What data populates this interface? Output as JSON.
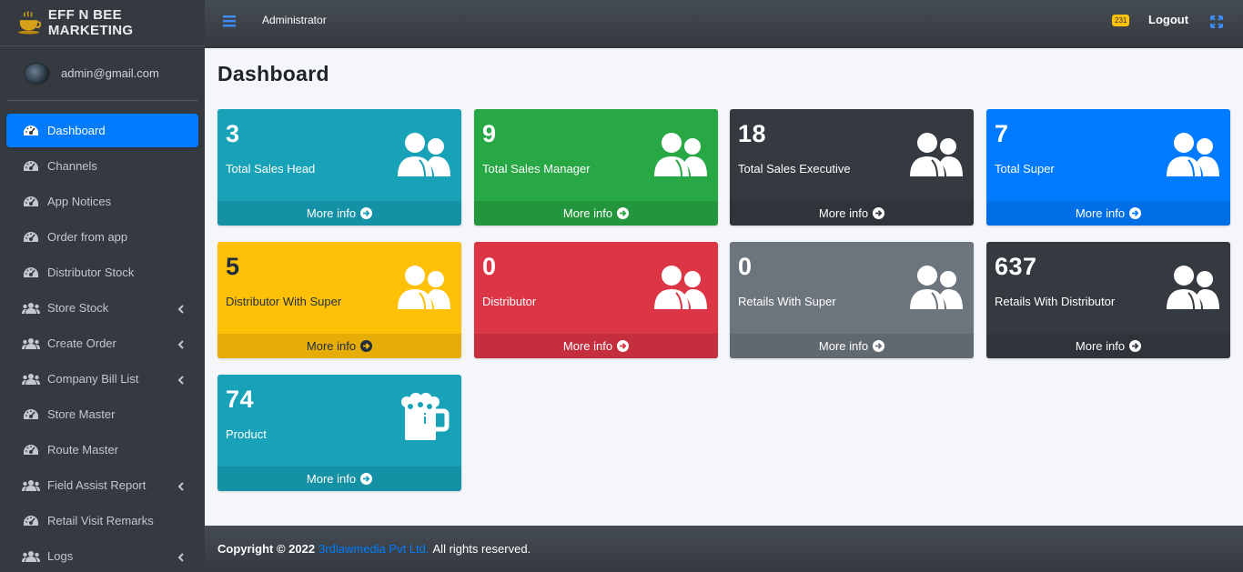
{
  "brand": {
    "name": "EFF N BEE MARKETING"
  },
  "user": {
    "email": "admin@gmail.com"
  },
  "sidebar": {
    "items": [
      {
        "label": "Dashboard",
        "icon": "tachometer-icon",
        "active": true,
        "arrow": false
      },
      {
        "label": "Channels",
        "icon": "tachometer-icon",
        "active": false,
        "arrow": false
      },
      {
        "label": "App Notices",
        "icon": "tachometer-icon",
        "active": false,
        "arrow": false
      },
      {
        "label": "Order from app",
        "icon": "tachometer-icon",
        "active": false,
        "arrow": false
      },
      {
        "label": "Distributor Stock",
        "icon": "tachometer-icon",
        "active": false,
        "arrow": false
      },
      {
        "label": "Store Stock",
        "icon": "users-icon",
        "active": false,
        "arrow": true
      },
      {
        "label": "Create Order",
        "icon": "users-icon",
        "active": false,
        "arrow": true
      },
      {
        "label": "Company Bill List",
        "icon": "users-icon",
        "active": false,
        "arrow": true
      },
      {
        "label": "Store Master",
        "icon": "tachometer-icon",
        "active": false,
        "arrow": false
      },
      {
        "label": "Route Master",
        "icon": "tachometer-icon",
        "active": false,
        "arrow": false
      },
      {
        "label": "Field Assist Report",
        "icon": "users-icon",
        "active": false,
        "arrow": true
      },
      {
        "label": "Retail Visit Remarks",
        "icon": "tachometer-icon",
        "active": false,
        "arrow": false
      },
      {
        "label": "Logs",
        "icon": "users-icon",
        "active": false,
        "arrow": true
      }
    ]
  },
  "navbar": {
    "title": "Administrator",
    "notification_count": "231",
    "logout_label": "Logout"
  },
  "page": {
    "title": "Dashboard"
  },
  "cards": [
    {
      "value": "3",
      "label": "Total Sales Head",
      "footer": "More info",
      "color": "#17a2b8",
      "icon": "user-group-icon"
    },
    {
      "value": "9",
      "label": "Total Sales Manager",
      "footer": "More info",
      "color": "#28a745",
      "icon": "user-group-icon"
    },
    {
      "value": "18",
      "label": "Total Sales Executive",
      "footer": "More info",
      "color": "#343a40",
      "icon": "user-group-icon"
    },
    {
      "value": "7",
      "label": "Total Super",
      "footer": "More info",
      "color": "#007bff",
      "icon": "user-group-icon"
    },
    {
      "value": "5",
      "label": "Distributor With Super",
      "footer": "More info",
      "color": "#ffc107",
      "icon": "user-group-icon"
    },
    {
      "value": "0",
      "label": "Distributor",
      "footer": "More info",
      "color": "#dc3545",
      "icon": "user-group-icon"
    },
    {
      "value": "0",
      "label": "Retails With Super",
      "footer": "More info",
      "color": "#6c757d",
      "icon": "user-group-icon"
    },
    {
      "value": "637",
      "label": "Retails With Distributor",
      "footer": "More info",
      "color": "#343a40",
      "icon": "user-group-icon"
    },
    {
      "value": "74",
      "label": "Product",
      "footer": "More info",
      "color": "#17a2b8",
      "icon": "beer-mug-icon"
    }
  ],
  "footer": {
    "copyright": "Copyright © 2022",
    "company": "3rdlawmedia Pvt Ltd.",
    "rights": "All rights reserved."
  }
}
